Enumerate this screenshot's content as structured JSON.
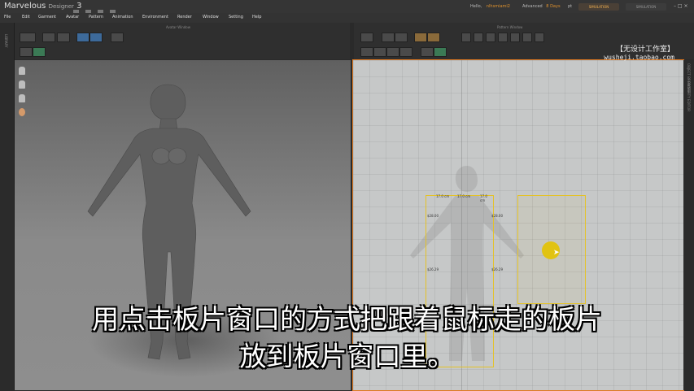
{
  "app": {
    "name": "Marvelous",
    "subname": "Designer",
    "version": "3"
  },
  "header": {
    "hello_label": "Hello,",
    "username": "nlhsmiami2",
    "license": "Advanced",
    "days": "8 Days",
    "misc": "pt",
    "simulation_primary": "SIMULATION",
    "simulation_secondary": "SIMULATION",
    "window_controls": "–  □  ×"
  },
  "menu": [
    "File",
    "Edit",
    "Garment",
    "Avatar",
    "Pattern",
    "Animation",
    "Environment",
    "Render",
    "Window",
    "Setting",
    "Help"
  ],
  "panels": {
    "avatar_window_title": "Avatar Window",
    "pattern_window_title": "Pattern Window",
    "left_side_label": "LIBRARY",
    "right_side_label": "PROPERTY EDITOR",
    "right_side_label2": "OBJECT BROWSER"
  },
  "watermark": {
    "line1": "【无设计工作室】",
    "line2": "wusheji.taobao.com"
  },
  "pattern_labels": {
    "p1_top": [
      "17.0 cm",
      "17.0 cm",
      "17.0 cm"
    ],
    "p1_side_upper": [
      "$28.00",
      "$28.00"
    ],
    "p1_side_lower": [
      "$26.29",
      "$26.29"
    ]
  },
  "subtitles": {
    "line1": "用点击板片窗口的方式把跟着鼠标走的板片",
    "line2": "放到板片窗口里。"
  },
  "colors": {
    "accent_orange": "#e07a22",
    "pattern_yellow": "#e4c228"
  }
}
